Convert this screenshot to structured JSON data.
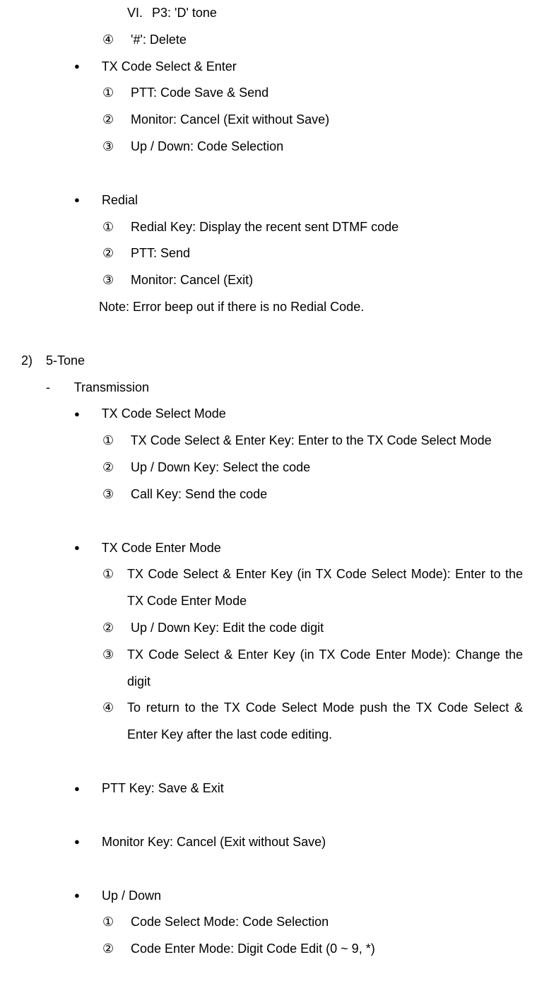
{
  "line1": {
    "marker": "VI.",
    "text": "P3: 'D' tone"
  },
  "line2": {
    "marker": "④",
    "text": "'#': Delete"
  },
  "line3": {
    "marker": "●",
    "text": "TX Code Select & Enter"
  },
  "line4": {
    "marker": "①",
    "text": "PTT: Code Save & Send"
  },
  "line5": {
    "marker": "②",
    "text": "Monitor: Cancel (Exit without Save)"
  },
  "line6": {
    "marker": "③",
    "text": "Up / Down: Code Selection"
  },
  "line7": {
    "marker": "●",
    "text": "Redial"
  },
  "line8": {
    "marker": "①",
    "text": "Redial Key: Display the recent sent DTMF code"
  },
  "line9": {
    "marker": "②",
    "text": "PTT: Send"
  },
  "line10": {
    "marker": "③",
    "text": "Monitor: Cancel (Exit)"
  },
  "line11": "Note: Error beep out if there is no Redial Code.",
  "line12": {
    "marker": "2)",
    "text": "5-Tone"
  },
  "line13": {
    "marker": "-",
    "text": "Transmission"
  },
  "line14": {
    "marker": "●",
    "text": "TX Code Select Mode"
  },
  "line15": {
    "marker": "①",
    "text": "TX Code Select & Enter Key: Enter to the TX Code Select Mode"
  },
  "line16": {
    "marker": "②",
    "text": "Up / Down Key: Select the code"
  },
  "line17": {
    "marker": "③",
    "text": "Call Key: Send the code"
  },
  "line18": {
    "marker": "●",
    "text": "TX Code Enter Mode"
  },
  "line19": {
    "marker": "①",
    "text": "TX Code Select & Enter Key (in TX Code Select Mode): Enter to the TX Code Enter Mode"
  },
  "line20": {
    "marker": "②",
    "text": "Up / Down Key: Edit the code digit"
  },
  "line21": {
    "marker": "③",
    "text": "TX Code Select & Enter Key (in TX Code Enter Mode): Change the digit"
  },
  "line22": {
    "marker": "④",
    "text": "To return to the TX Code Select Mode push the TX Code Select & Enter Key after the last code editing."
  },
  "line23": {
    "marker": "●",
    "text": "PTT Key: Save & Exit"
  },
  "line24": {
    "marker": "●",
    "text": "Monitor Key: Cancel (Exit without Save)"
  },
  "line25": {
    "marker": "●",
    "text": "Up / Down"
  },
  "line26": {
    "marker": "①",
    "text": "Code Select Mode: Code Selection"
  },
  "line27": {
    "marker": "②",
    "text": "Code Enter Mode: Digit Code Edit (0 ~ 9, *)"
  }
}
